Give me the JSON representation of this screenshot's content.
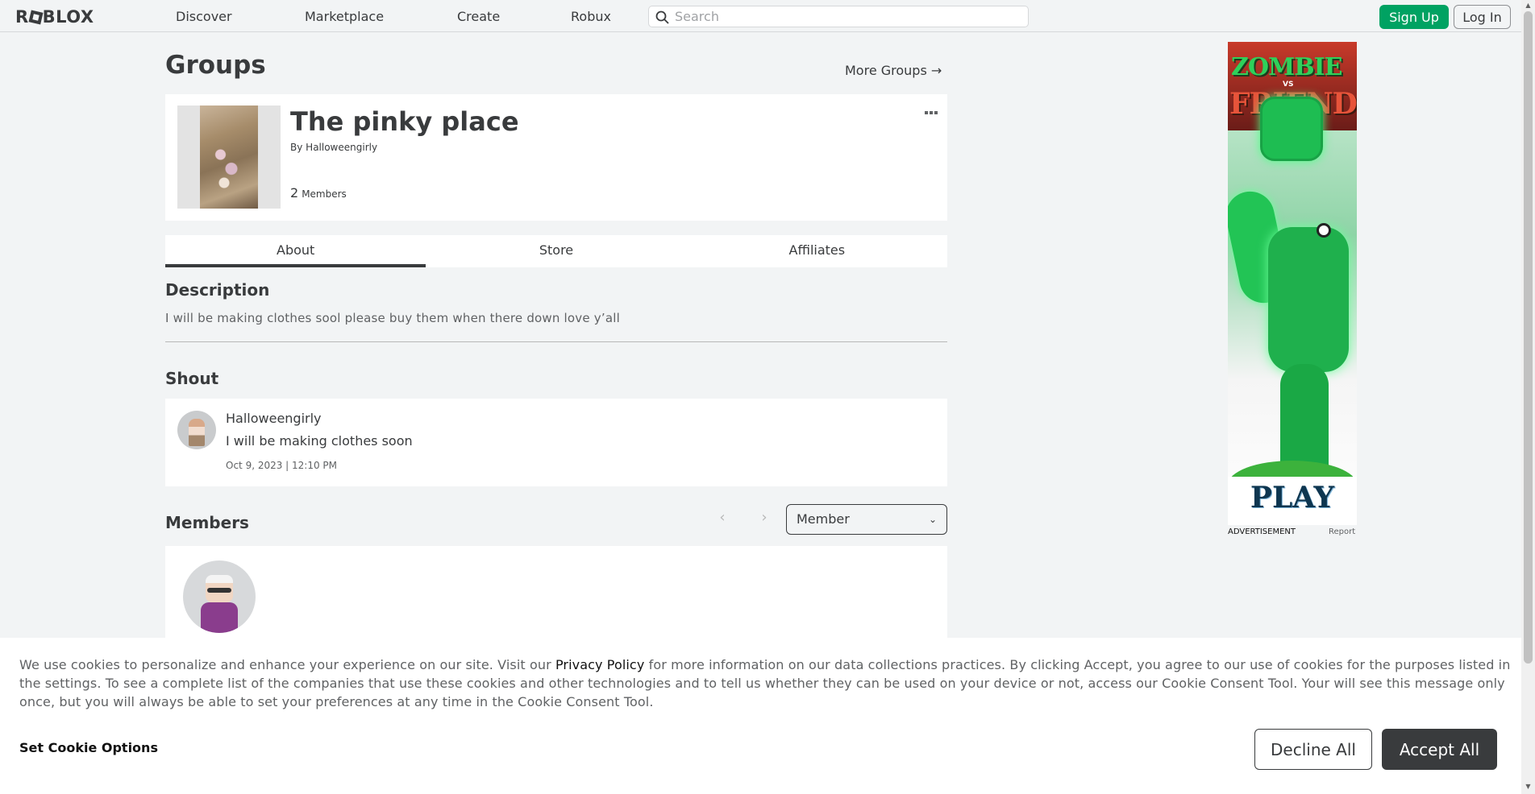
{
  "nav": {
    "logo": "ROBLOX",
    "links": [
      "Discover",
      "Marketplace",
      "Create",
      "Robux"
    ],
    "search_placeholder": "Search",
    "signup_label": "Sign Up",
    "login_label": "Log In"
  },
  "page": {
    "title": "Groups",
    "more_groups": "More Groups →"
  },
  "group": {
    "name": "The pinky place",
    "by_label": "By",
    "owner": "Halloweengirly",
    "member_count": "2",
    "members_label": "Members",
    "menu_icon": "ellipsis-icon"
  },
  "tabs": [
    {
      "label": "About",
      "active": true
    },
    {
      "label": "Store",
      "active": false
    },
    {
      "label": "Affiliates",
      "active": false
    }
  ],
  "about": {
    "description_title": "Description",
    "description_text": "I will be making clothes sool please buy them when there down love y’all",
    "shout_title": "Shout",
    "shout_user": "Halloweengirly",
    "shout_text": "I will be making clothes soon",
    "shout_time": "Oct 9, 2023 | 12:10 PM",
    "members_title": "Members",
    "role_selected": "Member"
  },
  "ad": {
    "title_line1": "ZOMBIE",
    "title_vs": "VS",
    "title_line2": "FRIEND",
    "cta": "PLAY",
    "label": "ADVERTISEMENT",
    "report": "Report"
  },
  "cookie": {
    "text_before": "We use cookies to personalize and enhance your experience on our site. Visit our ",
    "policy_link": "Privacy Policy",
    "text_after": " for more information on our data collections practices. By clicking Accept, you agree to our use of cookies for the purposes listed in the settings. To see a complete list of the companies that use these cookies and other technologies and to tell us whether they can be used on your device or not, access our Cookie Consent Tool. Your will see this message only once, but you will always be able to set your preferences at any time in the Cookie Consent Tool.",
    "set_options": "Set Cookie Options",
    "decline": "Decline All",
    "accept": "Accept All"
  },
  "colors": {
    "signup_green": "#00a262",
    "text_dark": "#393b3d",
    "background": "#f2f4f5"
  }
}
